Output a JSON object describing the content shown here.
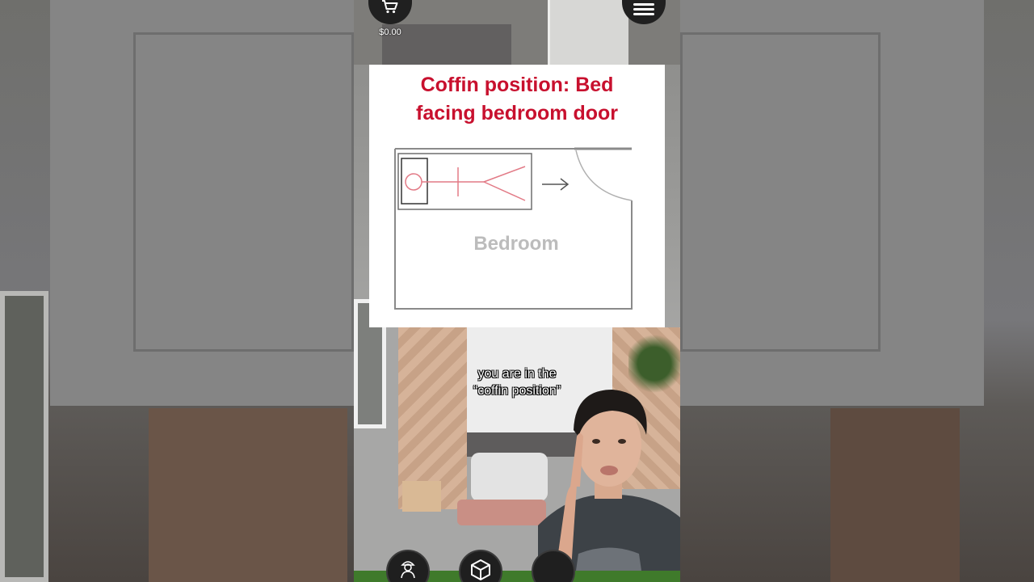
{
  "toolbar": {
    "cart_icon": "shopping-cart-icon",
    "price": "$0.00",
    "menu_icon": "hamburger-menu-icon"
  },
  "diagram": {
    "title_line1": "Coffin position: Bed",
    "title_line2": "facing bedroom door",
    "room_label": "Bedroom",
    "colors": {
      "title": "#c8102e",
      "figure": "#e27a86",
      "outline": "#8a8a8a",
      "label": "#bcbcbc"
    }
  },
  "caption": {
    "line1": "you are in the",
    "line2": "“coffin position”"
  },
  "bottom_toolbar": {
    "icons": [
      "builder-character-icon",
      "cube-3d-icon",
      "more-icon"
    ]
  }
}
